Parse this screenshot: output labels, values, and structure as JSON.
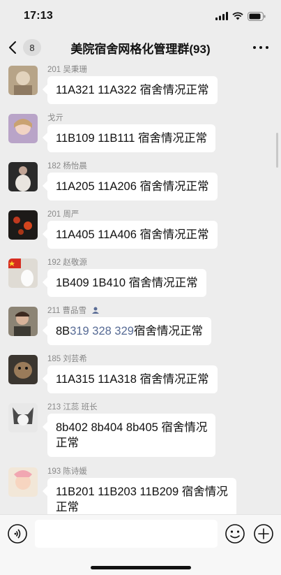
{
  "status_bar": {
    "time": "17:13"
  },
  "header": {
    "unread_count": "8",
    "title": "美院宿舍网格化管理群(93)"
  },
  "messages": [
    {
      "sender": "201 吴秉珊",
      "text": "11A321 11A322 宿舍情况正常"
    },
    {
      "sender": "戈亓",
      "text": "11B109 11B111 宿舍情况正常"
    },
    {
      "sender": "182 杨怡晨",
      "text": "11A205  11A206 宿舍情况正常"
    },
    {
      "sender": "201 周严",
      "text": "11A405 11A406 宿舍情况正常"
    },
    {
      "sender": "192 赵敬源",
      "text": "1B409 1B410 宿舍情况正常"
    },
    {
      "sender": "211 曹品雪",
      "text_prefix": "8B",
      "text_link": "319 328 329",
      "text_suffix": "宿舍情况正常"
    },
    {
      "sender": "185 刘芸希",
      "text": "11A315  11A318 宿舍情况正常"
    },
    {
      "sender": "213 江蕊 班长",
      "text_line1": "8b402 8b404 8b405 宿舍情况",
      "text_line2": "正常"
    },
    {
      "sender": "193 陈诗媛",
      "text_line1": "11B201 11B203 11B209 宿舍情况",
      "text_line2": "正常"
    }
  ],
  "input": {
    "placeholder": ""
  },
  "icons": {
    "back": "chevron-left-icon",
    "more": "more-dots-icon",
    "voice": "voice-icon",
    "emoji": "emoji-icon",
    "plus": "plus-icon"
  }
}
